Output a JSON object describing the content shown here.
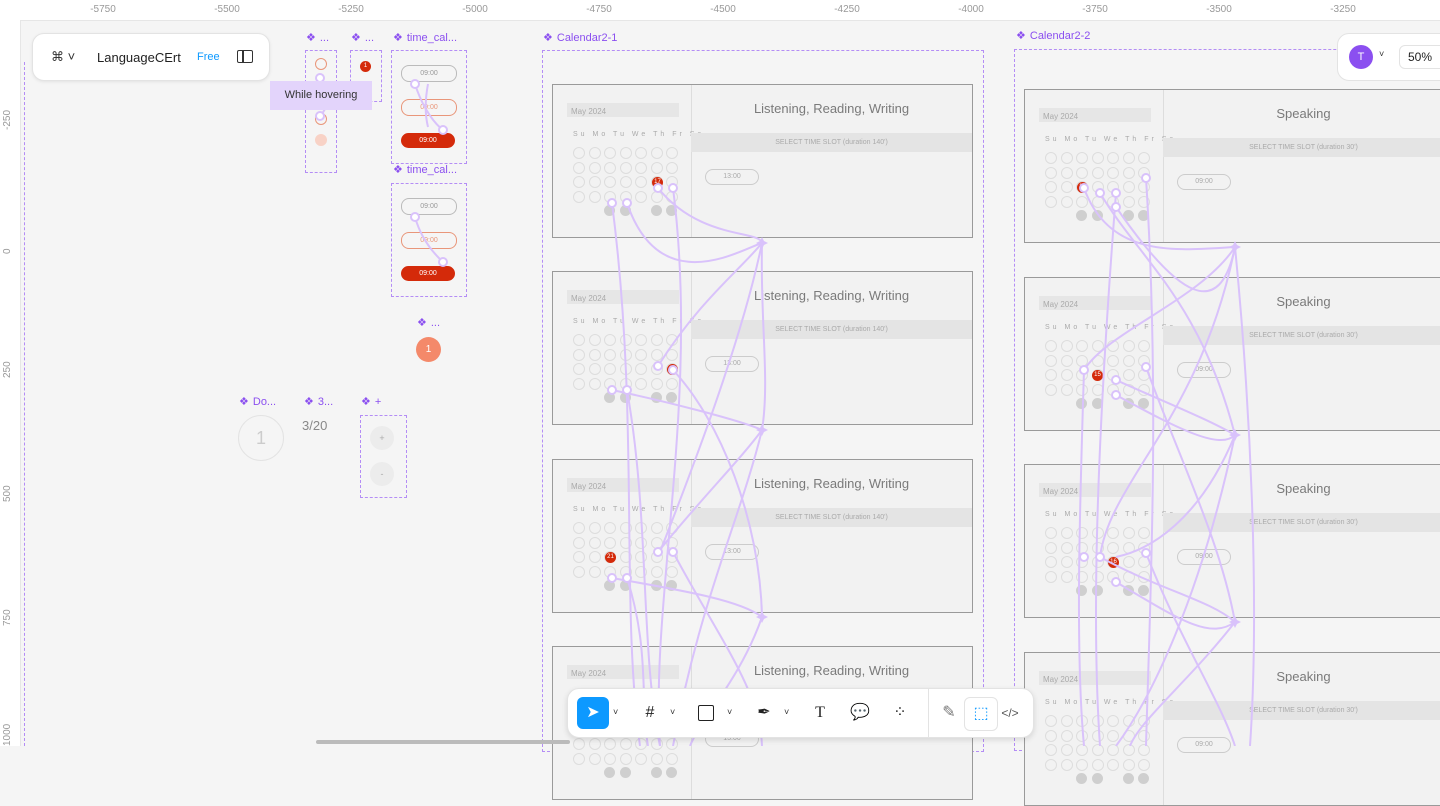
{
  "file": {
    "name": "LanguageCErt",
    "plan": "Free"
  },
  "user": {
    "initial": "T"
  },
  "zoom": "50%",
  "tooltip": "While hovering",
  "ruler_top": [
    "-5750",
    "-5500",
    "-5250",
    "-5000",
    "-4750",
    "-4500",
    "-4250",
    "-4000",
    "-3750",
    "-3500",
    "-3250"
  ],
  "ruler_left": [
    "-250",
    "0",
    "250",
    "500",
    "750",
    "1000"
  ],
  "frames": {
    "calendar1": "Calendar2-1",
    "calendar2": "Calendar2-2",
    "timecal1": "time_cal...",
    "timecal2": "time_cal...",
    "small1": "...",
    "small2": "...",
    "small3": "...",
    "do": "Do...",
    "three": "3...",
    "plus": "+"
  },
  "counter": "3/20",
  "day_num": "1",
  "stepper": {
    "plus": "+",
    "minus": "-"
  },
  "time_pill": "09:00",
  "cards_left": {
    "title": "Listening, Reading, Writing",
    "slot_header": "SELECT TIME SLOT (duration 140')",
    "slot": "13:00",
    "month": "May 2024",
    "days": "Su Mo Tu We Th Fr Sa",
    "selected": [
      "17",
      "18",
      "21",
      ""
    ]
  },
  "cards_right": {
    "title": "Speaking",
    "slot_header": "SELECT TIME SLOT (duration 30')",
    "slot": "09:00",
    "month": "May 2024",
    "days": "Su Mo Tu We Th Fr Sa",
    "selected": [
      "14",
      "15",
      "16",
      ""
    ]
  },
  "toolbar": {
    "move": "move-tool",
    "frame": "frame-tool",
    "shape": "rectangle-tool",
    "pen": "pen-tool",
    "text": "T",
    "comment": "comment-tool",
    "actions": "actions-tool",
    "draw": "draw-mode",
    "design": "design-mode",
    "dev": "dev-mode"
  }
}
